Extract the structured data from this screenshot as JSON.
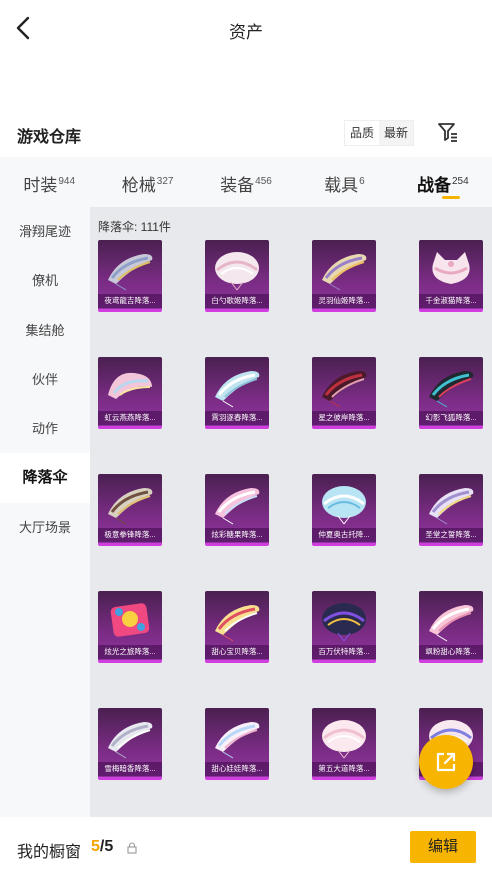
{
  "header": {
    "title": "资产",
    "back_icon": "chevron-left-icon"
  },
  "warehouse": {
    "title": "游戏仓库",
    "sort_options": [
      "品质",
      "最新"
    ],
    "filter_icon": "filter-icon"
  },
  "tabs": [
    {
      "label": "时装",
      "count": "944"
    },
    {
      "label": "枪械",
      "count": "327"
    },
    {
      "label": "装备",
      "count": "456"
    },
    {
      "label": "载具",
      "count": "6"
    },
    {
      "label": "战备",
      "count": "254",
      "active": true
    }
  ],
  "sidebar": {
    "items": [
      "滑翔尾迹",
      "僚机",
      "集结舱",
      "伙伴",
      "动作",
      "降落伞",
      "大厅场景"
    ],
    "active_index": 5
  },
  "content": {
    "count_label": "降落伞: 111件",
    "items": [
      {
        "name": "夜鸢龍吉降落...",
        "shape": "wing",
        "palette": [
          "#c8c8d8",
          "#8fa0c8",
          "#e0c060"
        ]
      },
      {
        "name": "白勺歌姬降落...",
        "shape": "dome",
        "palette": [
          "#f4e8ee",
          "#e6b6c8",
          "#ffffff"
        ]
      },
      {
        "name": "灵羽仙姬降落...",
        "shape": "wing",
        "palette": [
          "#e8d8b0",
          "#9a80c8",
          "#f0c060"
        ]
      },
      {
        "name": "千金淑猫降落...",
        "shape": "cat",
        "palette": [
          "#f7e4ec",
          "#e8a8c0",
          "#ffffff"
        ]
      },
      {
        "name": "虹云燕燕降落...",
        "shape": "fan",
        "palette": [
          "#f2c6d8",
          "#b8d8f0",
          "#f8e6a0"
        ]
      },
      {
        "name": "霄羽逐春降落...",
        "shape": "wing",
        "palette": [
          "#bfe3ef",
          "#ffffff",
          "#8ec0d8"
        ]
      },
      {
        "name": "星之彼岸降落...",
        "shape": "wing",
        "palette": [
          "#4a1a2a",
          "#c03040",
          "#e0a0b0"
        ]
      },
      {
        "name": "幻影飞狐降落...",
        "shape": "wing",
        "palette": [
          "#202830",
          "#40c0d0",
          "#e04060"
        ]
      },
      {
        "name": "极意拳锋降落...",
        "shape": "wing",
        "palette": [
          "#d8d0c0",
          "#705040",
          "#e0c070"
        ]
      },
      {
        "name": "炫彩糖果降落...",
        "shape": "wing",
        "palette": [
          "#f6c2dd",
          "#ffffff",
          "#c8e0f8"
        ]
      },
      {
        "name": "仲夏奥古托降...",
        "shape": "dome",
        "palette": [
          "#b8e4f4",
          "#ffffff",
          "#68bce0"
        ]
      },
      {
        "name": "圣堂之誓降落...",
        "shape": "wing",
        "palette": [
          "#e8e0f4",
          "#a090d0",
          "#f0d880"
        ]
      },
      {
        "name": "炫光之旅降落...",
        "shape": "square",
        "palette": [
          "#f04880",
          "#40a0e0",
          "#f8d040"
        ]
      },
      {
        "name": "甜心宝贝降落...",
        "shape": "wing",
        "palette": [
          "#f8e090",
          "#e05060",
          "#ffffff"
        ]
      },
      {
        "name": "百万伏特降落...",
        "shape": "dome",
        "palette": [
          "#2a2a50",
          "#8050e0",
          "#f0c040"
        ]
      },
      {
        "name": "飒粉甜心降落...",
        "shape": "wing",
        "palette": [
          "#f7c5d7",
          "#ffffff",
          "#e890b0"
        ]
      },
      {
        "name": "雪梅暗香降落...",
        "shape": "wing",
        "palette": [
          "#e8e8f0",
          "#b0b0c8",
          "#ffffff"
        ]
      },
      {
        "name": "甜心娃娃降落...",
        "shape": "wing",
        "palette": [
          "#f8f0f8",
          "#b8d8f8",
          "#f0b0d0"
        ]
      },
      {
        "name": "第五大道降落...",
        "shape": "dome",
        "palette": [
          "#fbe9ef",
          "#f0c0d0",
          "#ffffff"
        ]
      },
      {
        "name": "",
        "shape": "dome",
        "palette": [
          "#f8e8f0",
          "#8080e0",
          "#ffffff"
        ]
      }
    ]
  },
  "fab": {
    "icon": "share-out-icon"
  },
  "bottom": {
    "label": "我的橱窗",
    "current": "5",
    "separator": "/",
    "total": "5",
    "lock_icon": "lock-icon",
    "edit_label": "编辑"
  }
}
